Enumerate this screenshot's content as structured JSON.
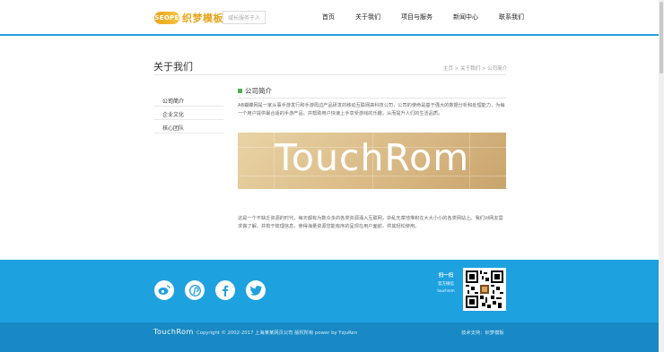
{
  "header": {
    "logo_mark": "SEOPE",
    "logo_text": "织梦模板",
    "slogan": "域长服务于人",
    "nav": [
      "首页",
      "关于我们",
      "项目与服务",
      "新闻中心",
      "联系我们"
    ]
  },
  "page": {
    "title": "关于我们",
    "breadcrumb": "主页 > 关于我们 > 公司简介"
  },
  "sidebar": {
    "items": [
      "公司简介",
      "企业文化",
      "核心团队"
    ]
  },
  "content": {
    "section_title": "公司简介",
    "para1": "AB蝴蝶网是一家从事手游发行和手游周边产品研发的移动互联网高科技公司，公司的使命是基于强大的数据分析和处理能力，为每一个用户提供最合适的手游产品，并帮助用户快速上手享受游戏的乐趣，从而提升人们的生活品质。",
    "banner_text": "TouchRom",
    "para2": "这是一个不缺乏资源的时代，每天都有为数众多的各类资源涌入互联网，杂乱无章地堆积在大大小小的各类网站上。我们对网友需求做了解，并梳于梳理信息，使得海量资源您能有序的呈现在用户面前，供其轻松使用。"
  },
  "footer": {
    "social_icons": [
      "weibo-icon",
      "pinterest-icon",
      "facebook-icon",
      "twitter-icon"
    ],
    "qr_label_1": "扫一扫",
    "qr_label_2": "官方微信",
    "qr_label_3": "touchrom"
  },
  "bottombar": {
    "logo": "TouchRom",
    "copyright": "Copyright © 2002-2017 上海某某网页公司 版权所有 power by YzjuRen",
    "tech": "技术支持：织梦模板"
  },
  "colors": {
    "accent": "#1ea1df",
    "bottom": "#1889c4",
    "logo": "#e8a317",
    "section_marker": "#4caf50"
  }
}
